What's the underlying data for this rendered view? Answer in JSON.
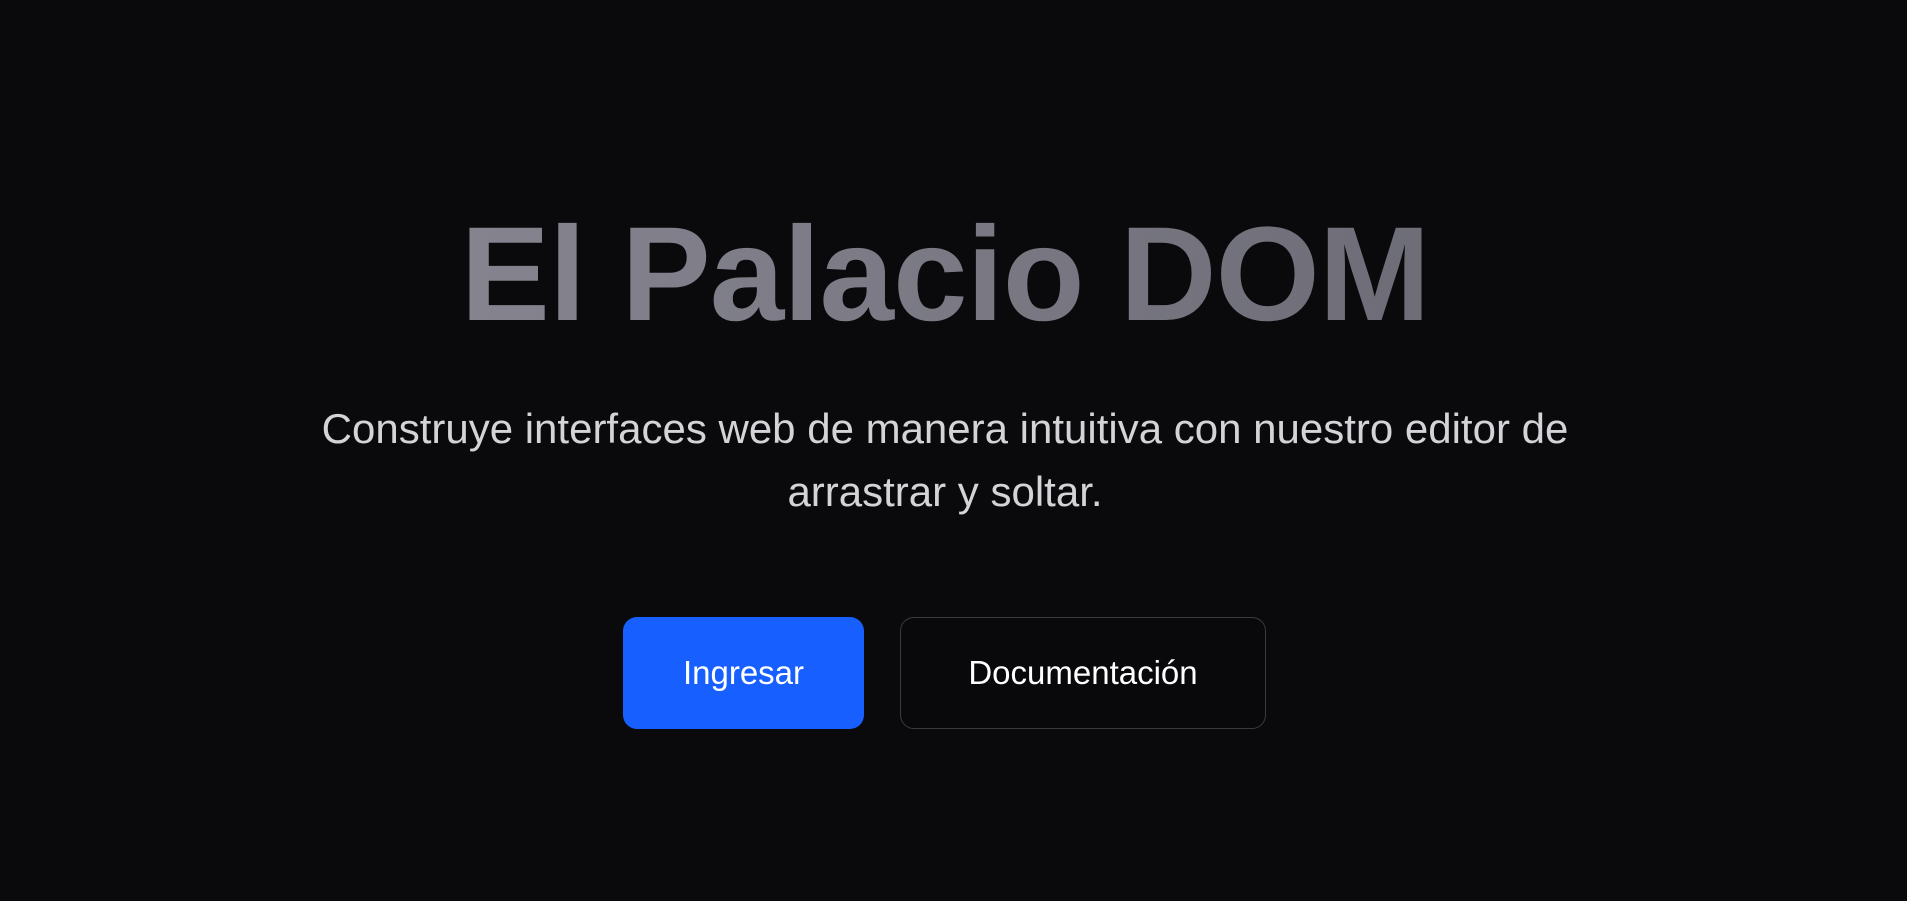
{
  "hero": {
    "title": "El Palacio DOM",
    "subtitle": "Construye interfaces web de manera intuitiva con nuestro editor de arrastrar y soltar.",
    "primary_button_label": "Ingresar",
    "secondary_button_label": "Documentación"
  },
  "colors": {
    "background": "#0a0a0c",
    "title_gradient_start": "#8e8d98",
    "title_gradient_end": "#62616b",
    "subtitle": "#d4d4d8",
    "primary_accent": "#1760ff",
    "secondary_border": "#3a3a40"
  }
}
